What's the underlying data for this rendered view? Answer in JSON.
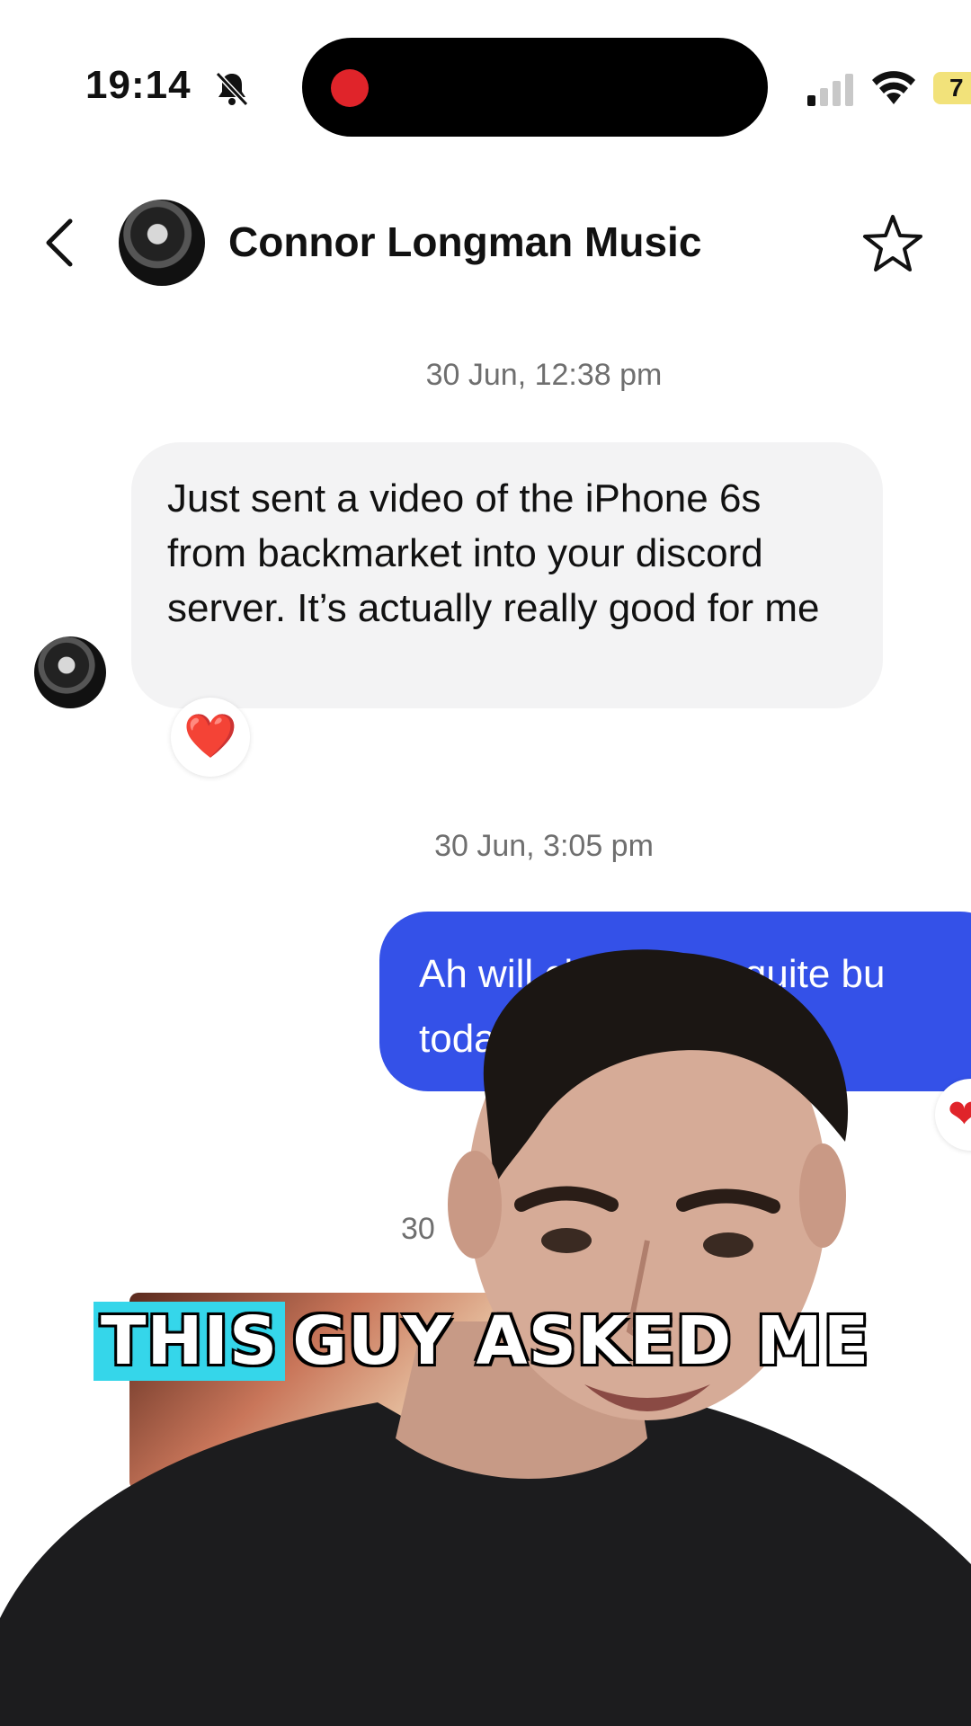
{
  "status_bar": {
    "time": "19:14",
    "battery": "7",
    "icons": [
      "bell-slash-icon",
      "signal-icon",
      "wifi-icon",
      "battery-icon"
    ]
  },
  "header": {
    "title": "Connor Longman Music",
    "back_icon": "chevron-left-icon",
    "favorite_icon": "star-icon"
  },
  "messages": [
    {
      "timestamp": "30 Jun, 12:38 pm",
      "direction": "incoming",
      "text": "Just sent a video of the iPhone 6s from backmarket into your discord server. It’s actually really good for me",
      "reaction": "❤️"
    },
    {
      "timestamp": "30 Jun, 3:05 pm",
      "direction": "outgoing",
      "text_line1": "Ah will check. Got quite bu",
      "text_line2": "today",
      "reaction": "❤"
    },
    {
      "timestamp": "30"
    }
  ],
  "caption": {
    "highlight": "THIS",
    "rest": "GUY ASKED ME",
    "highlight_color": "#35d6ea"
  },
  "colors": {
    "outgoing_bubble": "#3451e8",
    "incoming_bubble": "#f3f3f4",
    "record_dot": "#e0242a"
  }
}
